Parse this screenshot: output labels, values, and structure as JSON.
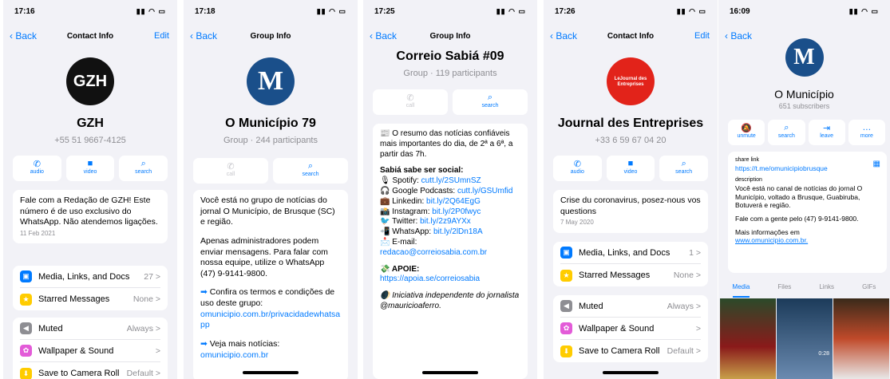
{
  "p1": {
    "time": "17:16",
    "back": "Back",
    "title": "Contact Info",
    "edit": "Edit",
    "avatar_text": "GZH",
    "name": "GZH",
    "phone": "+55 51 9667-4125",
    "actions": [
      "audio",
      "video",
      "search"
    ],
    "about": "Fale com a Redação de GZH! Este número é de uso exclusivo do WhatsApp. Não atendemos ligações.",
    "about_date": "11 Feb 2021",
    "rows1": [
      {
        "label": "Media, Links, and Docs",
        "value": "27 >"
      },
      {
        "label": "Starred Messages",
        "value": "None >"
      }
    ],
    "rows2": [
      {
        "label": "Muted",
        "value": "Always >"
      },
      {
        "label": "Wallpaper & Sound",
        "value": ">"
      },
      {
        "label": "Save to Camera Roll",
        "value": "Default >"
      }
    ]
  },
  "p2": {
    "time": "17:18",
    "back": "Back",
    "title": "Group Info",
    "avatar_text": "M",
    "name": "O Município 79",
    "sub": "Group · 244 participants",
    "actions": [
      "call",
      "search"
    ],
    "desc1": "Você está no grupo de notícias do jornal O Município, de Brusque (SC) e região.",
    "desc2": "Apenas administradores podem enviar mensagens. Para falar com nossa equipe, utilize o WhatsApp (47) 9-9141-9800.",
    "desc3": "Confira os termos e condições de uso deste grupo:",
    "link1": "omunicipio.com.br/privacidadewhatsapp",
    "desc4": "Veja mais notícias:",
    "link2": "omunicipio.com.br"
  },
  "p3": {
    "time": "17:25",
    "back": "Back",
    "title": "Group Info",
    "name": "Correio Sabiá #09",
    "sub": "Group · 119 participants",
    "actions": [
      "call",
      "search"
    ],
    "intro": "O resumo das notícias confiáveis mais importantes do dia, de 2ª a 6ª, a partir das 7h.",
    "social_title": "Sabiá sabe ser social:",
    "social": [
      {
        "label": "Spotify:",
        "link": "cutt.ly/2SUmnSZ"
      },
      {
        "label": "Google Podcasts:",
        "link": "cutt.ly/GSUmfid"
      },
      {
        "label": "Linkedin:",
        "link": "bit.ly/2Q64EgG"
      },
      {
        "label": "Instagram:",
        "link": "bit.ly/2P0fwyc"
      },
      {
        "label": "Twitter:",
        "link": "bit.ly/2z9AYXx"
      },
      {
        "label": "WhatsApp:",
        "link": "bit.ly/2lDn18A"
      },
      {
        "label": "E-mail:",
        "link": "redacao@correiosabia.com.br"
      }
    ],
    "apoie": "APOIE:",
    "apoie_link": "https://apoia.se/correiosabia",
    "footer": "Iniciativa independente do jornalista @mauricioaferro."
  },
  "p4": {
    "time": "17:26",
    "back": "Back",
    "title": "Contact Info",
    "edit": "Edit",
    "avatar_text": "LeJournal des Entreprises",
    "name": "Journal des Entreprises",
    "phone": "+33 6 59 67 04 20",
    "actions": [
      "audio",
      "video",
      "search"
    ],
    "about": "Crise du coronavirus, posez-nous vos questions",
    "about_date": "7 May 2020",
    "rows1": [
      {
        "label": "Media, Links, and Docs",
        "value": "1 >"
      },
      {
        "label": "Starred Messages",
        "value": "None >"
      }
    ],
    "rows2": [
      {
        "label": "Muted",
        "value": "Always >"
      },
      {
        "label": "Wallpaper & Sound",
        "value": ">"
      },
      {
        "label": "Save to Camera Roll",
        "value": "Default >"
      }
    ]
  },
  "p5": {
    "time": "16:09",
    "back": "Back",
    "avatar_text": "M",
    "name": "O Município",
    "sub": "651 subscribers",
    "actions": [
      "unmute",
      "search",
      "leave",
      "more"
    ],
    "share_label": "share link",
    "share_link": "https://t.me/omunicipiobrusque",
    "desc_label": "description",
    "desc1": "Você está no canal de notícias do jornal O Município, voltado a Brusque, Guabiruba, Botuverá e região.",
    "desc2": "Fale com a gente pelo (47) 9-9141-9800.",
    "desc3": "Mais informações em",
    "desc_link": "www.omunicipio.com.br.",
    "tabs": [
      "Media",
      "Files",
      "Links",
      "GIFs"
    ],
    "video_time": "0:28"
  },
  "colors": {
    "accent": "#007aff",
    "bg": "#f2f2f7",
    "gzh": "#111111",
    "municipio": "#1a4f8a",
    "journal": "#e2231a"
  }
}
